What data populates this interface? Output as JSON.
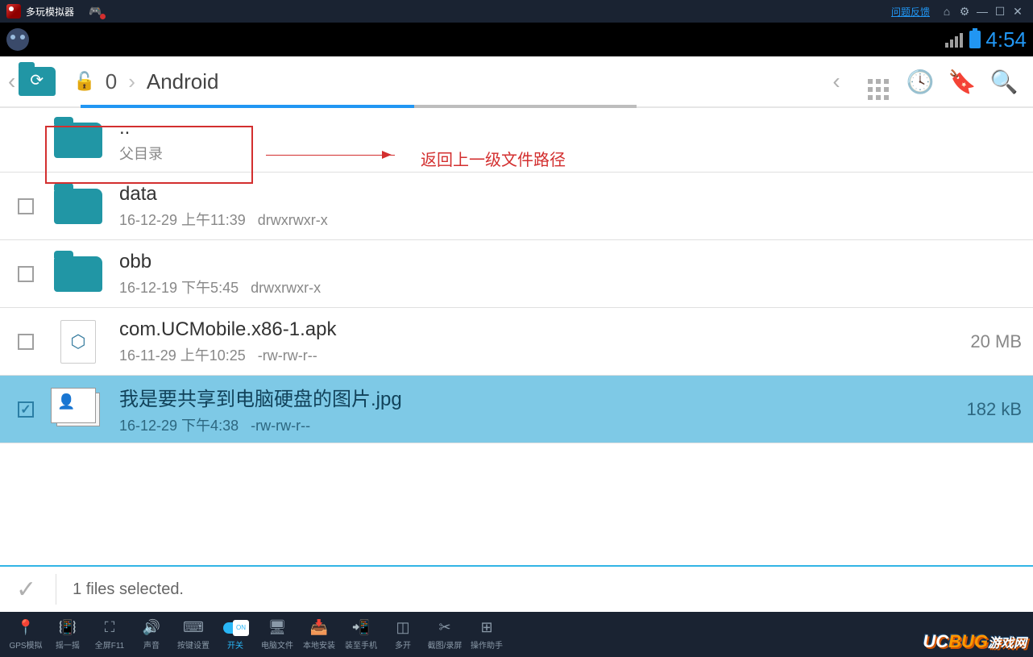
{
  "emulator": {
    "title": "多玩模拟器",
    "feedback": "问题反馈",
    "bottom_buttons": [
      {
        "icon": "📍",
        "label": "GPS模拟"
      },
      {
        "icon": "📳",
        "label": "摇一摇"
      },
      {
        "icon": "⛶",
        "label": "全屏F11"
      },
      {
        "icon": "🔊",
        "label": "声音"
      },
      {
        "icon": "⌨",
        "label": "按键设置"
      },
      {
        "icon": "toggle",
        "label": "开关",
        "active": true
      },
      {
        "icon": "🖥",
        "label": "电脑文件"
      },
      {
        "icon": "📥",
        "label": "本地安装"
      },
      {
        "icon": "📲",
        "label": "装至手机"
      },
      {
        "icon": "◫",
        "label": "多开"
      },
      {
        "icon": "✂",
        "label": "截图/录屏"
      },
      {
        "icon": "⊞",
        "label": "操作助手"
      }
    ]
  },
  "android": {
    "time": "4:54"
  },
  "toolbar": {
    "crumb_root": "0",
    "crumb_path": "Android"
  },
  "annotation": {
    "text": "返回上一级文件路径"
  },
  "files": [
    {
      "name": "..",
      "sub": "父目录",
      "type": "parent"
    },
    {
      "name": "data",
      "date": "16-12-29 上午11:39",
      "perm": "drwxrwxr-x",
      "type": "folder"
    },
    {
      "name": "obb",
      "date": "16-12-19 下午5:45",
      "perm": "drwxrwxr-x",
      "type": "folder"
    },
    {
      "name": "com.UCMobile.x86-1.apk",
      "date": "16-11-29 上午10:25",
      "perm": "-rw-rw-r--",
      "size": "20 MB",
      "type": "apk"
    },
    {
      "name": "我是要共享到电脑硬盘的图片.jpg",
      "date": "16-12-29 下午4:38",
      "perm": "-rw-rw-r--",
      "size": "182 kB",
      "type": "jpg",
      "selected": true
    }
  ],
  "footer": {
    "text": "1 files selected."
  },
  "watermark": {
    "a": "UC",
    "b": "BUG",
    "c": "游戏网"
  }
}
